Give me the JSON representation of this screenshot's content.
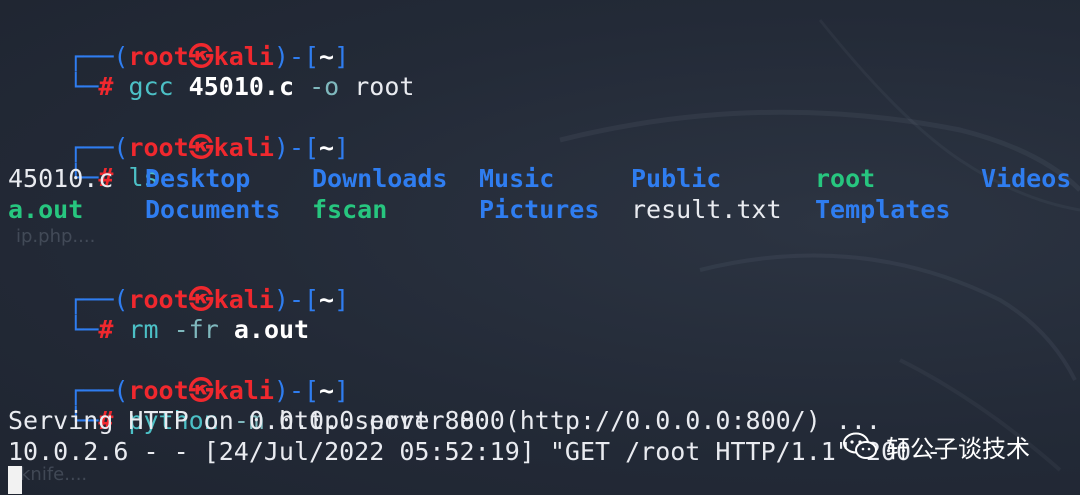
{
  "prompts": [
    {
      "user": "root",
      "host": "kali",
      "dir": "~",
      "command": "gcc",
      "args": [
        " ",
        "45010.c",
        " ",
        "-o",
        " root"
      ]
    },
    {
      "user": "root",
      "host": "kali",
      "dir": "~",
      "command": "ls"
    },
    {
      "user": "root",
      "host": "kali",
      "dir": "~",
      "command": "rm",
      "args": [
        " ",
        "-fr",
        " ",
        "a.out"
      ]
    },
    {
      "user": "root",
      "host": "kali",
      "dir": "~",
      "command": "python",
      "args": [
        " ",
        "-m",
        " http.server 800"
      ]
    }
  ],
  "prompt_symbols": {
    "corner_top": "┌──",
    "corner_bottom": "└─",
    "hash": "#",
    "skull": "㉿"
  },
  "ls_output": [
    [
      "45010.c",
      "Desktop",
      "Downloads",
      "Music",
      "Public",
      "root",
      "Videos"
    ],
    [
      "a.out",
      "Documents",
      "fscan",
      "Pictures",
      "result.txt",
      "Templates"
    ]
  ],
  "server_output": [
    "Serving HTTP on 0.0.0.0 port 800 (http://0.0.0.0:800/) ...",
    "10.0.2.6 - - [24/Jul/2022 05:52:19] \"GET /root HTTP/1.1\" 200 -"
  ],
  "watermark": {
    "text": "轩公子谈技术"
  },
  "background_text": [
    "ip.php....",
    "knife...."
  ],
  "colors": {
    "background": "#232a37",
    "prompt_bracket": "#2f7df0",
    "user_host": "#f0282e",
    "command": "#4cc0c6",
    "directory": "#2f7df0",
    "executable": "#27c67f",
    "text": "#e9ebf0"
  }
}
